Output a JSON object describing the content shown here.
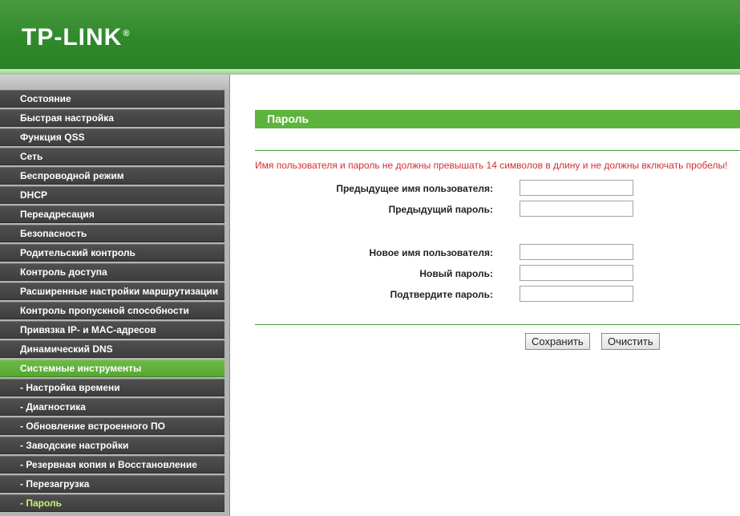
{
  "header": {
    "logo_text": "TP-LINK",
    "logo_reg": "®",
    "colors": {
      "bar": "#2f8a2b",
      "accent": "#5cb43c"
    }
  },
  "sidebar": {
    "items": [
      {
        "label": "Состояние"
      },
      {
        "label": "Быстрая настройка"
      },
      {
        "label": "Функция QSS"
      },
      {
        "label": "Сеть"
      },
      {
        "label": "Беспроводной режим"
      },
      {
        "label": "DHCP"
      },
      {
        "label": "Переадресация"
      },
      {
        "label": "Безопасность"
      },
      {
        "label": "Родительский контроль"
      },
      {
        "label": "Контроль доступа"
      },
      {
        "label": "Расширенные настройки маршрутизации"
      },
      {
        "label": "Контроль пропускной способности"
      },
      {
        "label": "Привязка IP- и MAC-адресов"
      },
      {
        "label": "Динамический DNS"
      },
      {
        "label": "Системные инструменты",
        "state": "active"
      },
      {
        "label": "- Настройка времени"
      },
      {
        "label": "- Диагностика"
      },
      {
        "label": "- Обновление встроенного ПО"
      },
      {
        "label": "- Заводские настройки"
      },
      {
        "label": "- Резервная копия и Восстановление"
      },
      {
        "label": "- Перезагрузка"
      },
      {
        "label": "- Пароль",
        "state": "current"
      }
    ]
  },
  "main": {
    "section_title": "Пароль",
    "warning": "Имя пользователя и пароль не должны превышать 14 символов в длину и не должны включать пробелы!",
    "fields": {
      "old_username": {
        "label": "Предыдущее имя пользователя:",
        "value": ""
      },
      "old_password": {
        "label": "Предыдущий пароль:",
        "value": ""
      },
      "new_username": {
        "label": "Новое имя пользователя:",
        "value": ""
      },
      "new_password": {
        "label": "Новый пароль:",
        "value": ""
      },
      "confirm_password": {
        "label": "Подтвердите пароль:",
        "value": ""
      }
    },
    "buttons": {
      "save": "Сохранить",
      "clear": "Очистить"
    }
  }
}
